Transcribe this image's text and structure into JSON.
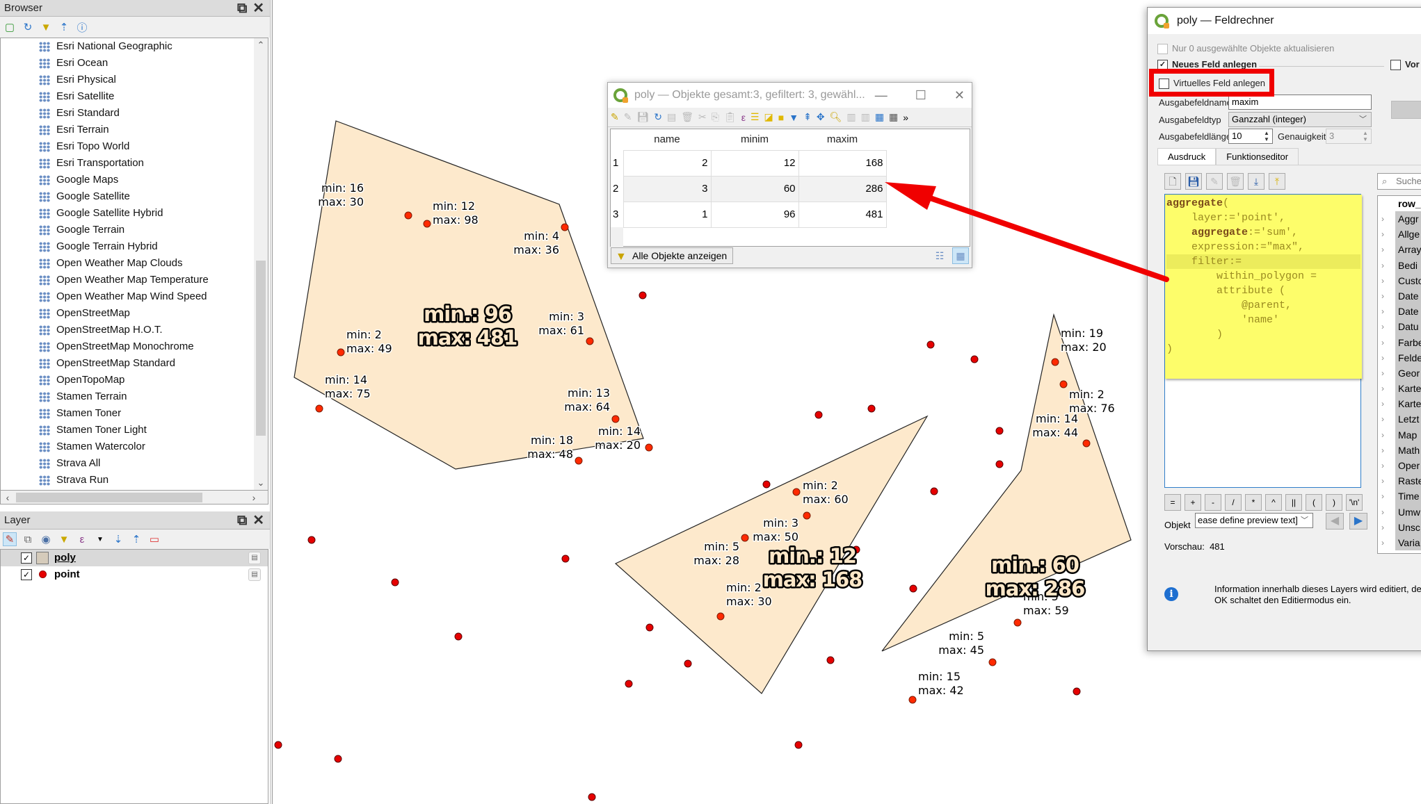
{
  "browser_panel": {
    "title": "Browser",
    "toolbar_icons": [
      "add-layer-icon",
      "refresh-icon",
      "filter-icon",
      "collapse-icon",
      "info-icon"
    ],
    "items": [
      "Esri National Geographic",
      "Esri Ocean",
      "Esri Physical",
      "Esri Satellite",
      "Esri Standard",
      "Esri Terrain",
      "Esri Topo World",
      "Esri Transportation",
      "Google Maps",
      "Google Satellite",
      "Google Satellite Hybrid",
      "Google Terrain",
      "Google Terrain Hybrid",
      "Open Weather Map Clouds",
      "Open Weather Map Temperature",
      "Open Weather Map Wind Speed",
      "OpenStreetMap",
      "OpenStreetMap H.O.T.",
      "OpenStreetMap Monochrome",
      "OpenStreetMap Standard",
      "OpenTopoMap",
      "Stamen Terrain",
      "Stamen Toner",
      "Stamen Toner Light",
      "Stamen Watercolor",
      "Strava All",
      "Strava Run"
    ]
  },
  "layer_panel": {
    "title": "Layer",
    "layers": [
      {
        "name": "poly",
        "checked": true,
        "selected": true
      },
      {
        "name": "point",
        "checked": true,
        "selected": false
      }
    ]
  },
  "map": {
    "polygon_fill": "#fde9cc",
    "point_color": "#e60000",
    "polygons": [
      {
        "label_min": "min.: 96",
        "label_max": "max: 481",
        "points": [
          {
            "min": "min: 16",
            "max": "max: 30"
          },
          {
            "min": "min: 12",
            "max": "max: 98"
          },
          {
            "min": "min: 4",
            "max": "max: 36"
          },
          {
            "min": "min: 2",
            "max": "max: 49"
          },
          {
            "min": "min: 3",
            "max": "max: 61"
          },
          {
            "min": "min: 14",
            "max": "max: 75"
          },
          {
            "min": "min: 13",
            "max": "max: 64"
          },
          {
            "min": "min: 14",
            "max": "max: 20"
          },
          {
            "min": "min: 18",
            "max": "max: 48"
          }
        ]
      },
      {
        "label_min": "min.: 12",
        "label_max": "max: 168",
        "points": [
          {
            "min": "min: 2",
            "max": "max: 60"
          },
          {
            "min": "min: 3",
            "max": "max: 50"
          },
          {
            "min": "min: 5",
            "max": "max: 28"
          },
          {
            "min": "min: 2",
            "max": "max: 30"
          }
        ]
      },
      {
        "label_min": "min.: 60",
        "label_max": "max: 286",
        "points": [
          {
            "min": "min: 19",
            "max": "max: 20"
          },
          {
            "min": "min: 2",
            "max": "max: 76"
          },
          {
            "min": "min: 14",
            "max": "max: 44"
          },
          {
            "min": "min: 5",
            "max": "max: 59"
          },
          {
            "min": "min: 5",
            "max": "max: 45"
          },
          {
            "min": "min: 15",
            "max": "max: 42"
          }
        ]
      }
    ]
  },
  "attribute_table": {
    "title": "poly — Objekte gesamt:3, gefiltert: 3, gewähl...",
    "columns": [
      "name",
      "minim",
      "maxim"
    ],
    "rows": [
      {
        "id": "1",
        "name": "2",
        "minim": "12",
        "maxim": "168"
      },
      {
        "id": "2",
        "name": "3",
        "minim": "60",
        "maxim": "286"
      },
      {
        "id": "3",
        "name": "1",
        "minim": "96",
        "maxim": "481"
      }
    ],
    "filter_button": "Alle Objekte anzeigen"
  },
  "field_calculator": {
    "title": "poly — Feldrechner",
    "only_selected": "Nur 0 ausgewählte Objekte aktualisieren",
    "new_field": "Neues Feld anlegen",
    "new_field_checked": true,
    "update_existing_partial": "Vor",
    "virtual_field": "Virtuelles Feld anlegen",
    "virtual_field_checked": false,
    "output_name_label": "Ausgabefeldname",
    "output_name_value": "maxim",
    "output_type_label": "Ausgabefeldtyp",
    "output_type_value": "Ganzzahl (integer)",
    "output_length_label": "Ausgabefeldlänge",
    "output_length_value": "10",
    "precision_label": "Genauigkeit",
    "precision_value": "3",
    "tabs": [
      "Ausdruck",
      "Funktionseditor"
    ],
    "active_tab": "Ausdruck",
    "expression_lines": [
      {
        "text": "aggregate(",
        "kw": "aggregate"
      },
      {
        "text": "    layer:='point',"
      },
      {
        "text": "    aggregate:='sum',",
        "kw": "aggregate"
      },
      {
        "text": "    expression:=\"max\","
      },
      {
        "text": "    filter:=",
        "highlight": true
      },
      {
        "text": "        within_polygon ="
      },
      {
        "text": "        attribute ("
      },
      {
        "text": "            @parent,"
      },
      {
        "text": "            'name'"
      },
      {
        "text": "        )"
      },
      {
        "text": ")"
      }
    ],
    "operators": [
      "=",
      "+",
      "-",
      "/",
      "*",
      "^",
      "||",
      "(",
      ")",
      "'\\n'"
    ],
    "search_placeholder": "Suche",
    "function_header": "row_",
    "function_groups": [
      "Aggr",
      "Allge",
      "Array",
      "Bedi",
      "Custo",
      "Date",
      "Date",
      "Datu",
      "Farbe",
      "Felde",
      "Geor",
      "Karte",
      "Karte",
      "Letzt",
      "Map",
      "Math",
      "Oper",
      "Raste",
      "Time",
      "Umw",
      "Unsc",
      "Varia"
    ],
    "object_label": "Objekt",
    "object_value": "ease define preview text]",
    "preview_label": "Vorschau:",
    "preview_value": "481",
    "info_line1": "Information innerhalb dieses Layers wird editiert, de",
    "info_line2": "OK schaltet den Editiermodus ein."
  },
  "annotation": {
    "arrow_color": "#f00000",
    "highlight_color": "#f00000"
  }
}
